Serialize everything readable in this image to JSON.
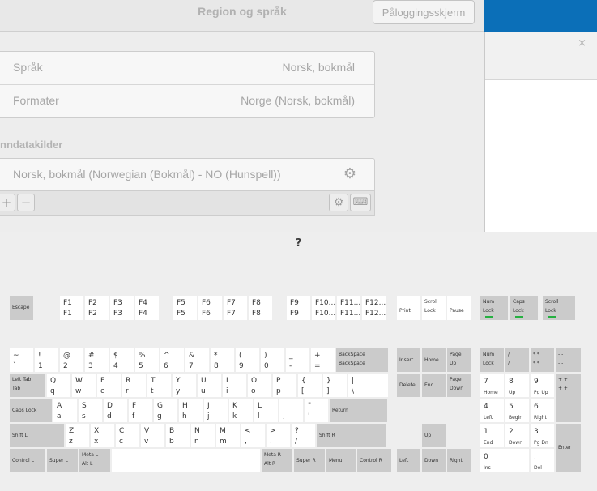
{
  "settings": {
    "title": "Region og språk",
    "login_screen_button": "Påloggingsskjerm",
    "rows": [
      {
        "label": "Språk",
        "value": "Norsk, bokmål"
      },
      {
        "label": "Formater",
        "value": "Norge (Norsk, bokmål)"
      }
    ],
    "input_sources_header": "nndatakilder",
    "input_source": "Norsk, bokmål (Norwegian (Bokmål) - NO (Hunspell))",
    "toolbar": {
      "add": "+",
      "remove": "−"
    }
  },
  "keyboard": {
    "title": "?",
    "fkeys": [
      {
        "name": "escape",
        "top": "",
        "bottom": "Escape"
      },
      {
        "name": "f1",
        "top": "F1",
        "bottom": "F1"
      },
      {
        "name": "f2",
        "top": "F2",
        "bottom": "F2"
      },
      {
        "name": "f3",
        "top": "F3",
        "bottom": "F3"
      },
      {
        "name": "f4",
        "top": "F4",
        "bottom": "F4"
      },
      {
        "name": "f5",
        "top": "F5",
        "bottom": "F5"
      },
      {
        "name": "f6",
        "top": "F6",
        "bottom": "F6"
      },
      {
        "name": "f7",
        "top": "F7",
        "bottom": "F7"
      },
      {
        "name": "f8",
        "top": "F8",
        "bottom": "F8"
      },
      {
        "name": "f9",
        "top": "F9",
        "bottom": "F9"
      },
      {
        "name": "f10",
        "top": "F10...",
        "bottom": "F10..."
      },
      {
        "name": "f11",
        "top": "F11...",
        "bottom": "F11..."
      },
      {
        "name": "f12",
        "top": "F12...",
        "bottom": "F12..."
      },
      {
        "name": "print",
        "top": "",
        "bottom": "Print"
      },
      {
        "name": "scroll-lock",
        "top": "Scroll",
        "bottom": "Lock"
      },
      {
        "name": "pause",
        "top": "",
        "bottom": "Pause"
      },
      {
        "name": "num-lock-ind",
        "top": "Num",
        "bottom": "Lock"
      },
      {
        "name": "caps-lock-ind",
        "top": "Caps",
        "bottom": "Lock"
      },
      {
        "name": "scroll-lock-ind",
        "top": "Scroll",
        "bottom": "Lock"
      }
    ],
    "rows": [
      [
        [
          "`",
          "~"
        ],
        [
          "1",
          "!"
        ],
        [
          "2",
          "@"
        ],
        [
          "3",
          "#"
        ],
        [
          "4",
          "$"
        ],
        [
          "5",
          "%"
        ],
        [
          "6",
          "^"
        ],
        [
          "7",
          "&"
        ],
        [
          "8",
          "*"
        ],
        [
          "9",
          "("
        ],
        [
          "0",
          ")"
        ],
        [
          "-",
          "_"
        ],
        [
          "=",
          "+"
        ],
        [
          "BackSpace",
          "BackSpace"
        ]
      ],
      [
        [
          "Tab",
          "Left Tab"
        ],
        [
          "q",
          "Q"
        ],
        [
          "w",
          "W"
        ],
        [
          "e",
          "E"
        ],
        [
          "r",
          "R"
        ],
        [
          "t",
          "T"
        ],
        [
          "y",
          "Y"
        ],
        [
          "u",
          "U"
        ],
        [
          "i",
          "I"
        ],
        [
          "o",
          "O"
        ],
        [
          "p",
          "P"
        ],
        [
          "[",
          "{"
        ],
        [
          "]",
          "}"
        ],
        [
          "\\",
          "|"
        ]
      ],
      [
        [
          "Caps Lock",
          ""
        ],
        [
          "a",
          "A"
        ],
        [
          "s",
          "S"
        ],
        [
          "d",
          "D"
        ],
        [
          "f",
          "F"
        ],
        [
          "g",
          "G"
        ],
        [
          "h",
          "H"
        ],
        [
          "j",
          "J"
        ],
        [
          "k",
          "K"
        ],
        [
          "l",
          "L"
        ],
        [
          ";",
          ":"
        ],
        [
          "'",
          "\""
        ],
        [
          "Return",
          ""
        ]
      ],
      [
        [
          "Shift L",
          ""
        ],
        [
          "z",
          "Z"
        ],
        [
          "x",
          "X"
        ],
        [
          "c",
          "C"
        ],
        [
          "v",
          "V"
        ],
        [
          "b",
          "B"
        ],
        [
          "n",
          "N"
        ],
        [
          "m",
          "M"
        ],
        [
          ",",
          "<"
        ],
        [
          ".",
          ">"
        ],
        [
          "/",
          "?"
        ],
        [
          "Shift R",
          ""
        ]
      ],
      [
        [
          "Control L",
          ""
        ],
        [
          "Super L",
          ""
        ],
        [
          "Alt L",
          "Meta L"
        ],
        [
          "",
          ""
        ],
        [
          "Alt R",
          "Meta R"
        ],
        [
          "Super R",
          ""
        ],
        [
          "Menu",
          ""
        ],
        [
          "Control R",
          ""
        ]
      ]
    ],
    "nav": [
      {
        "name": "insert",
        "top": "Insert",
        "bottom": ""
      },
      {
        "name": "home",
        "top": "Home",
        "bottom": ""
      },
      {
        "name": "page-up",
        "top": "Page",
        "bottom": "Up"
      },
      {
        "name": "delete",
        "top": "Delete",
        "bottom": ""
      },
      {
        "name": "end",
        "top": "End",
        "bottom": ""
      },
      {
        "name": "page-down",
        "top": "Page",
        "bottom": "Down"
      },
      {
        "name": "up",
        "top": "Up",
        "bottom": ""
      },
      {
        "name": "left",
        "top": "Left",
        "bottom": ""
      },
      {
        "name": "down",
        "top": "Down",
        "bottom": ""
      },
      {
        "name": "right",
        "top": "Right",
        "bottom": ""
      }
    ],
    "numpad": [
      {
        "name": "num-lock",
        "top": "Num",
        "bottom": "Lock"
      },
      {
        "name": "kp-divide",
        "top": "/",
        "bottom": "/"
      },
      {
        "name": "kp-multiply",
        "top": "*   *",
        "bottom": "*   *"
      },
      {
        "name": "kp-minus",
        "top": "-   -",
        "bottom": "-   -"
      },
      {
        "name": "kp-7",
        "top": "7",
        "bottom": "Home"
      },
      {
        "name": "kp-8",
        "top": "8",
        "bottom": "Up"
      },
      {
        "name": "kp-9",
        "top": "9",
        "bottom": "Pg Up"
      },
      {
        "name": "kp-plus",
        "top": "+   +",
        "bottom": "+   +"
      },
      {
        "name": "kp-4",
        "top": "4",
        "bottom": "Left"
      },
      {
        "name": "kp-5",
        "top": "5",
        "bottom": "Begin"
      },
      {
        "name": "kp-6",
        "top": "6",
        "bottom": "Right"
      },
      {
        "name": "kp-1",
        "top": "1",
        "bottom": "End"
      },
      {
        "name": "kp-2",
        "top": "2",
        "bottom": "Down"
      },
      {
        "name": "kp-3",
        "top": "3",
        "bottom": "Pg Dn"
      },
      {
        "name": "kp-enter",
        "top": "",
        "bottom": "Enter"
      },
      {
        "name": "kp-0",
        "top": "0",
        "bottom": "Ins"
      },
      {
        "name": "kp-decimal",
        "top": ".",
        "bottom": "Del"
      }
    ]
  }
}
